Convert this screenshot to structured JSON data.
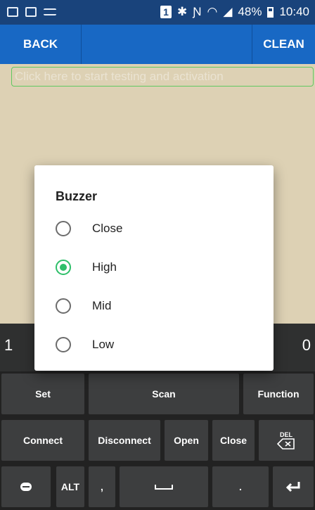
{
  "status_bar": {
    "notification_badge": "1",
    "bluetooth_icon": "bluetooth-icon",
    "nfc_icon": "nfc-icon",
    "wifi_icon": "wifi-icon",
    "battery": "48%",
    "time": "10:40"
  },
  "title_bar": {
    "back_label": "BACK",
    "clean_label": "CLEAN"
  },
  "content": {
    "activation_text": "Click here to start testing and activation"
  },
  "dialog": {
    "title": "Buzzer",
    "options": [
      {
        "label": "Close",
        "selected": false
      },
      {
        "label": "High",
        "selected": true
      },
      {
        "label": "Mid",
        "selected": false
      },
      {
        "label": "Low",
        "selected": false
      }
    ]
  },
  "keyboard": {
    "num_left": "1",
    "num_right": "0",
    "row1": [
      "Set",
      "Scan",
      "Function"
    ],
    "row2": [
      "Connect",
      "Disconnect",
      "Open",
      "Close",
      "DEL"
    ],
    "row3": {
      "alt": "ALT",
      "comma": ",",
      "period": "."
    }
  },
  "colors": {
    "statusbar": "#19437b",
    "titlebar": "#1868c4",
    "background": "#ddd1b4",
    "radio_selected": "#2fbf6a",
    "keyboard": "#222222"
  }
}
